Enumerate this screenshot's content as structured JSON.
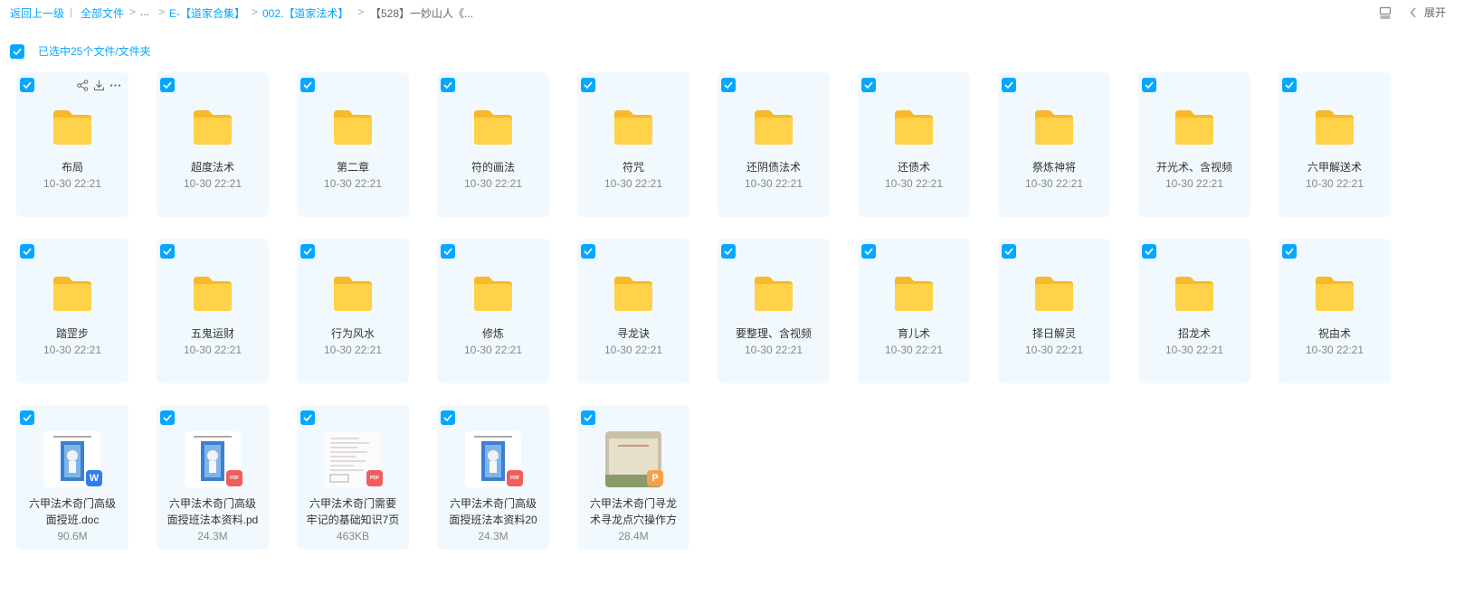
{
  "breadcrumb": {
    "back": "返回上一级",
    "sep": "|",
    "all_files": "全部文件",
    "arrow": ">",
    "ellipsis": "...",
    "level1": "E-【道家合集】",
    "level2": "002.【道家法术】",
    "current": "【528】一妙山人《..."
  },
  "top_right": {
    "expand": "展开"
  },
  "selection": {
    "text": "已选中25个文件/文件夹"
  },
  "folders": [
    {
      "name": "布局",
      "date": "10-30 22:21"
    },
    {
      "name": "超度法术",
      "date": "10-30 22:21"
    },
    {
      "name": "第二章",
      "date": "10-30 22:21"
    },
    {
      "name": "符的画法",
      "date": "10-30 22:21"
    },
    {
      "name": "符咒",
      "date": "10-30 22:21"
    },
    {
      "name": "还阴债法术",
      "date": "10-30 22:21"
    },
    {
      "name": "还债术",
      "date": "10-30 22:21"
    },
    {
      "name": "祭炼神将",
      "date": "10-30 22:21"
    },
    {
      "name": "开光术、含视频",
      "date": "10-30 22:21"
    },
    {
      "name": "六甲解送术",
      "date": "10-30 22:21"
    },
    {
      "name": "踏罡步",
      "date": "10-30 22:21"
    },
    {
      "name": "五鬼运财",
      "date": "10-30 22:21"
    },
    {
      "name": "行为风水",
      "date": "10-30 22:21"
    },
    {
      "name": "修炼",
      "date": "10-30 22:21"
    },
    {
      "name": "寻龙诀",
      "date": "10-30 22:21"
    },
    {
      "name": "要整理、含视频",
      "date": "10-30 22:21"
    },
    {
      "name": "育儿术",
      "date": "10-30 22:21"
    },
    {
      "name": "择日解灵",
      "date": "10-30 22:21"
    },
    {
      "name": "招龙术",
      "date": "10-30 22:21"
    },
    {
      "name": "祝由术",
      "date": "10-30 22:21"
    }
  ],
  "files": [
    {
      "line1": "六甲法术奇门高级",
      "line2": "面授班.doc",
      "size": "90.6M",
      "type": "W",
      "color": "#2e7cf6"
    },
    {
      "line1": "六甲法术奇门高级",
      "line2": "面授班法本资料.pd",
      "size": "24.3M",
      "type": "PDF",
      "color": "#f25c5c"
    },
    {
      "line1": "六甲法术奇门需要",
      "line2": "牢记的基础知识7页",
      "size": "463KB",
      "type": "PDF",
      "color": "#f25c5c"
    },
    {
      "line1": "六甲法术奇门高级",
      "line2": "面授班法本资料20",
      "size": "24.3M",
      "type": "PDF",
      "color": "#f25c5c"
    },
    {
      "line1": "六甲法术奇门寻龙",
      "line2": "术寻龙点穴操作方",
      "size": "28.4M",
      "type": "P",
      "color": "#f7a14a"
    }
  ]
}
